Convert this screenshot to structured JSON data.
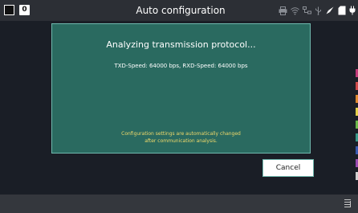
{
  "window": {
    "title": "Auto configuration",
    "badge": "0"
  },
  "status_icons": [
    "printer-icon",
    "wifi-icon",
    "network-icon",
    "usb-icon",
    "compass-icon",
    "sd-card-icon",
    "power-plug-icon"
  ],
  "dialog": {
    "heading": "Analyzing transmission protocol...",
    "speed_text": "TXD-Speed: 64000 bps, RXD-Speed: 64000 bps",
    "note_line1": "Configuration settings are automatically changed",
    "note_line2": "after communication analysis."
  },
  "buttons": {
    "cancel_label": "Cancel"
  },
  "bottom_bar": {
    "menu_icon": "menu-icon"
  },
  "colors": {
    "dialog_bg": "#2a6a60",
    "dialog_border": "#6fb8ad",
    "note_text": "#f0d96a",
    "screen_bg": "#1a1e26"
  }
}
